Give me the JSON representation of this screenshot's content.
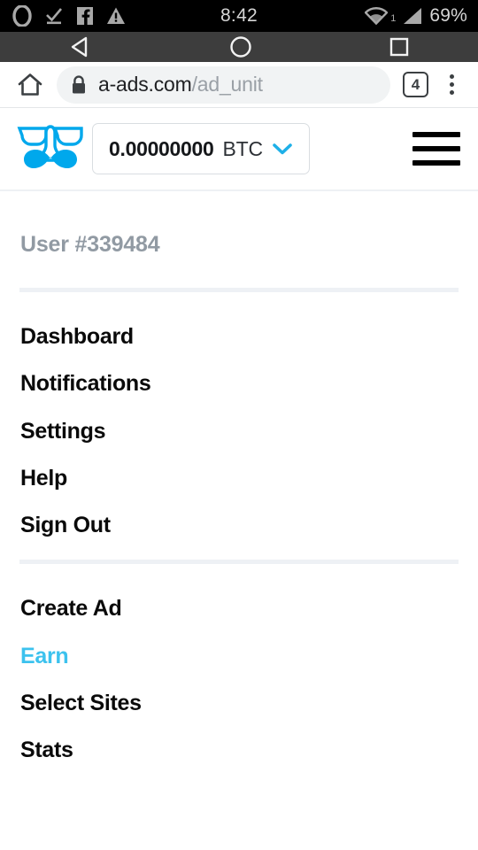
{
  "status_bar": {
    "clock": "8:42",
    "battery": "69%",
    "wifi_label": "1",
    "icons": [
      "opera-icon",
      "check-underline-icon",
      "facebook-icon",
      "warning-icon",
      "wifi-icon",
      "signal-icon"
    ]
  },
  "nav_bar": {
    "back": "back-triangle-icon",
    "home": "home-circle-icon",
    "recents": "recents-square-icon"
  },
  "browser": {
    "home_icon": "home-icon",
    "lock_icon": "lock-icon",
    "url_domain": "a-ads.com",
    "url_path": "/ad_unit",
    "tab_count": "4",
    "overflow_icon": "more-vertical-icon"
  },
  "site_header": {
    "logo_icon": "groucho-glasses-logo",
    "balance_amount": "0.00000000",
    "balance_unit": "BTC",
    "chevron_icon": "chevron-down-icon",
    "menu_icon": "hamburger-icon"
  },
  "drawer": {
    "user_label": "User #339484",
    "group_account": [
      {
        "label": "Dashboard",
        "name": "menu-item-dashboard",
        "active": false
      },
      {
        "label": "Notifications",
        "name": "menu-item-notifications",
        "active": false
      },
      {
        "label": "Settings",
        "name": "menu-item-settings",
        "active": false
      },
      {
        "label": "Help",
        "name": "menu-item-help",
        "active": false
      },
      {
        "label": "Sign Out",
        "name": "menu-item-sign-out",
        "active": false
      }
    ],
    "group_actions": [
      {
        "label": "Create Ad",
        "name": "menu-item-create-ad",
        "active": false
      },
      {
        "label": "Earn",
        "name": "menu-item-earn",
        "active": true
      },
      {
        "label": "Select Sites",
        "name": "menu-item-select-sites",
        "active": false
      },
      {
        "label": "Stats",
        "name": "menu-item-stats",
        "active": false
      }
    ]
  },
  "colors": {
    "accent": "#3cc2ee",
    "status_bar_bg": "#000000",
    "nav_bar_bg": "#3d3d3d",
    "url_pill_bg": "#f1f3f4",
    "divider": "#eef1f5",
    "muted_text": "#919aa3"
  }
}
